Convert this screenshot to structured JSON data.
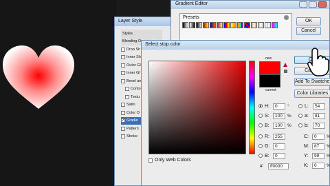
{
  "layer_style": {
    "title": "Layer Style",
    "header": "Styles",
    "items": [
      {
        "label": "Blending O",
        "checked": false,
        "head": true
      },
      {
        "label": "Drop Sh",
        "checked": false
      },
      {
        "label": "Inner Sh",
        "checked": false
      },
      {
        "label": "Outer Gl",
        "checked": false
      },
      {
        "label": "Inner Gl",
        "checked": false
      },
      {
        "label": "Bevel an",
        "checked": false
      },
      {
        "label": "Conto",
        "checked": false,
        "indent": true
      },
      {
        "label": "Textu",
        "checked": false,
        "indent": true
      },
      {
        "label": "Satin",
        "checked": false
      },
      {
        "label": "Color O",
        "checked": false
      },
      {
        "label": "Gradie",
        "checked": true,
        "selected": true
      },
      {
        "label": "Pattern",
        "checked": false
      },
      {
        "label": "Stroke",
        "checked": false
      }
    ]
  },
  "gradient_editor": {
    "title": "Gradient Editor",
    "presets_label": "Presets",
    "ok_label": "OK",
    "cancel_label": "Cancel"
  },
  "color_picker": {
    "title": "Select stop color",
    "new_label": "new",
    "current_label": "current",
    "new_color": "#ff0000",
    "current_color": "#000000",
    "ok_label": "OK",
    "cancel_label": "Cancel",
    "add_swatches_label": "Add To Swatches",
    "color_libraries_label": "Color Libraries",
    "only_web_colors_label": "Only Web Colors",
    "hsb": [
      {
        "label": "H:",
        "value": "0",
        "unit": "°",
        "selected": true
      },
      {
        "label": "S:",
        "value": "100",
        "unit": "%",
        "selected": false
      },
      {
        "label": "B:",
        "value": "100",
        "unit": "%",
        "selected": false
      }
    ],
    "rgb": [
      {
        "label": "R:",
        "value": "255",
        "selected": false
      },
      {
        "label": "G:",
        "value": "0",
        "selected": false
      },
      {
        "label": "B:",
        "value": "0",
        "selected": false
      }
    ],
    "hex_label": "#",
    "hex_value": "ff0000",
    "lab": [
      {
        "label": "L:",
        "value": "54"
      },
      {
        "label": "a:",
        "value": "81"
      },
      {
        "label": "b:",
        "value": "70"
      }
    ],
    "cmyk": [
      {
        "label": "C:",
        "value": "0",
        "unit": "%"
      },
      {
        "label": "M:",
        "value": "87",
        "unit": "%"
      },
      {
        "label": "Y:",
        "value": "99",
        "unit": "%"
      },
      {
        "label": "K:",
        "value": "0",
        "unit": "%"
      }
    ]
  }
}
